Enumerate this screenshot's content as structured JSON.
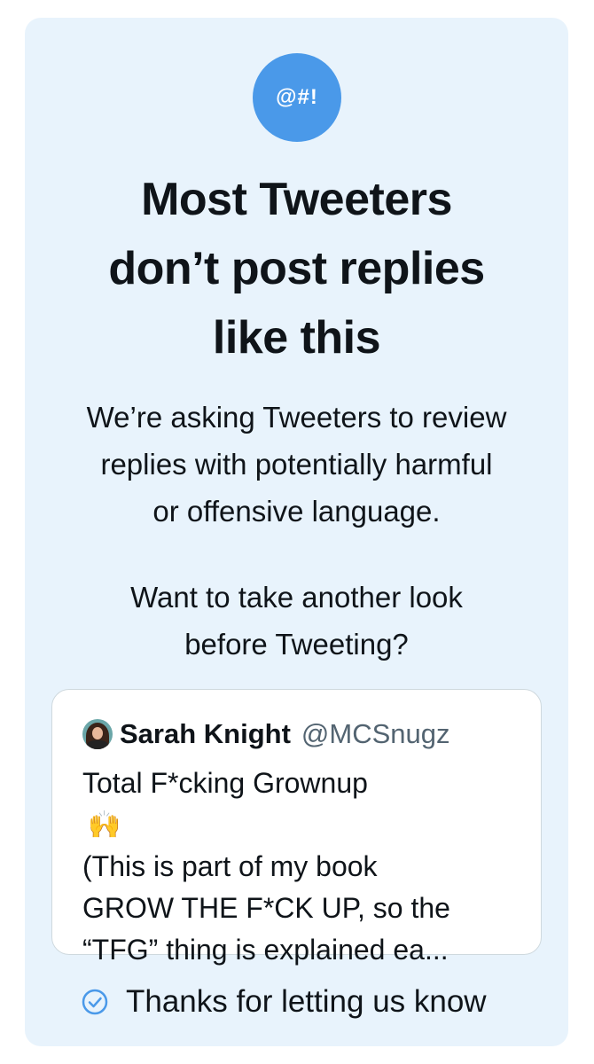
{
  "badge": {
    "symbol": "@#!",
    "color": "#4a99e9"
  },
  "title": {
    "lines": [
      "Most Tweeters",
      "don’t post replies",
      "like this"
    ]
  },
  "description": {
    "lines": [
      "We’re asking Tweeters to review",
      "replies with potentially harmful",
      "or offensive language."
    ]
  },
  "question": {
    "lines": [
      "Want to take another look",
      "before Tweeting?"
    ]
  },
  "quoted_tweet": {
    "avatar_icon": "avatar",
    "name": "Sarah Knight",
    "handle": "@MCSnugz",
    "text_lines": [
      "Total F*cking Grownup",
      "(This is part of my book",
      "GROW THE F*CK UP, so the",
      "“TFG” thing is explained ea..."
    ],
    "emoji": "🙌"
  },
  "footer": {
    "icon": "check-circle-icon",
    "label": "Thanks for letting us know",
    "icon_color": "#4a99e9"
  },
  "colors": {
    "card_background": "#e8f3fc",
    "accent": "#4a99e9",
    "text": "#0f1419",
    "secondary_text": "#536471"
  }
}
